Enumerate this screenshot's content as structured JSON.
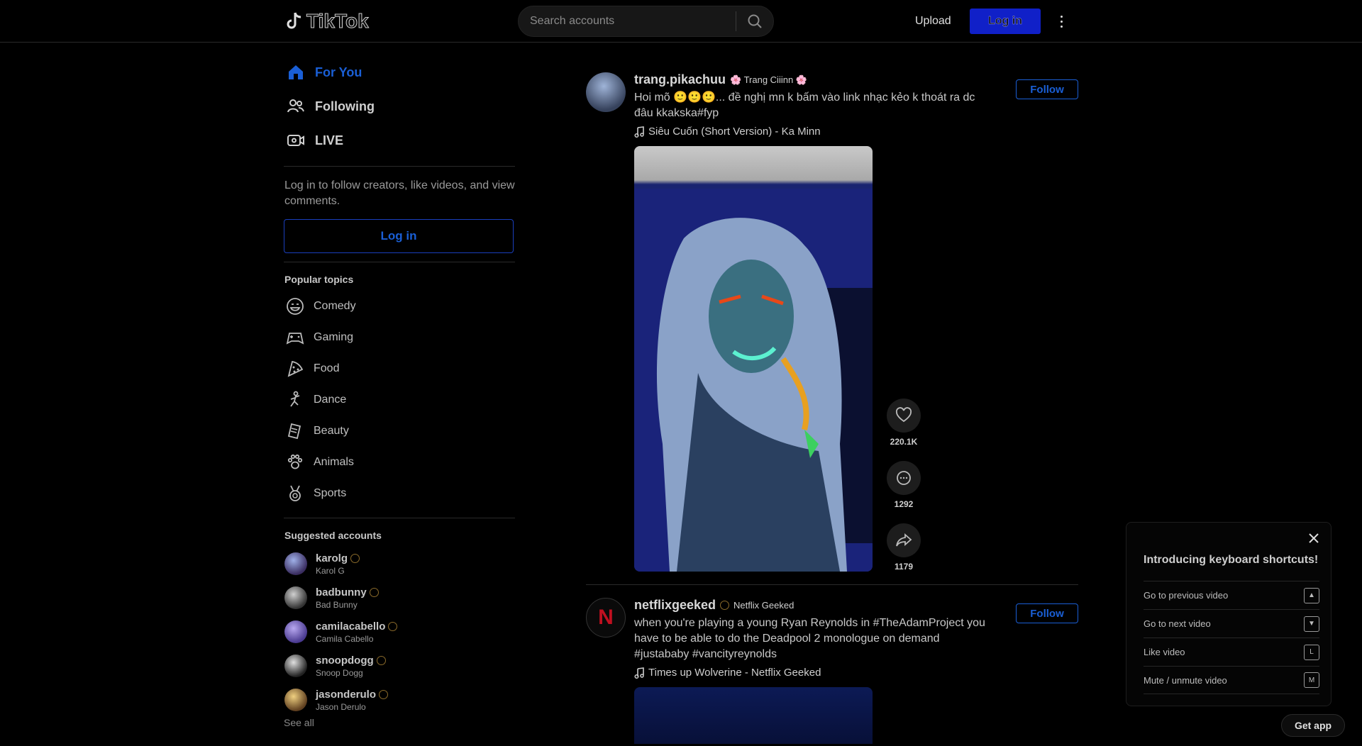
{
  "header": {
    "logo_text": "TikTok",
    "search_placeholder": "Search accounts",
    "upload_label": "Upload",
    "login_label": "Log in"
  },
  "sidebar": {
    "nav": [
      {
        "label": "For You",
        "icon": "home-icon"
      },
      {
        "label": "Following",
        "icon": "users-icon"
      },
      {
        "label": "LIVE",
        "icon": "live-icon"
      }
    ],
    "login_hint": "Log in to follow creators, like videos, and view comments.",
    "login_button": "Log in",
    "popular_title": "Popular topics",
    "topics": [
      "Comedy",
      "Gaming",
      "Food",
      "Dance",
      "Beauty",
      "Animals",
      "Sports"
    ],
    "suggested_title": "Suggested accounts",
    "accounts": [
      {
        "handle": "karolg",
        "name": "Karol G"
      },
      {
        "handle": "badbunny",
        "name": "Bad Bunny"
      },
      {
        "handle": "camilacabello",
        "name": "Camila Cabello"
      },
      {
        "handle": "snoopdogg",
        "name": "Snoop Dogg"
      },
      {
        "handle": "jasonderulo",
        "name": "Jason Derulo"
      }
    ],
    "see_all": "See all"
  },
  "feed": {
    "posts": [
      {
        "handle": "trang.pikachuu",
        "nickname": "🌸 Trang Ciiinn 🌸",
        "caption": "Hoi mõ 🙂🙂🙂... đề nghị mn k bấm vào link nhạc kẻo k thoát ra dc đâu kkakska#fyp",
        "music": "Siêu Cuốn (Short Version) - Ka Minn",
        "follow": "Follow",
        "likes": "220.1K",
        "comments": "1292",
        "shares": "1179"
      },
      {
        "handle": "netflixgeeked",
        "nickname": "Netflix Geeked",
        "caption": "when you're playing a young Ryan Reynolds in #TheAdamProject you have to be able to do the Deadpool 2 monologue on demand #justababy #vancityreynolds",
        "music": "Times up Wolverine - Netflix Geeked",
        "follow": "Follow"
      }
    ]
  },
  "keyboard": {
    "title": "Introducing keyboard shortcuts!",
    "shortcuts": [
      {
        "label": "Go to previous video",
        "icon": "arrow-up-key-icon"
      },
      {
        "label": "Go to next video",
        "icon": "arrow-down-key-icon"
      },
      {
        "label": "Like video",
        "icon": "l-key-icon"
      },
      {
        "label": "Mute / unmute video",
        "icon": "m-key-icon"
      }
    ]
  },
  "get_app": "Get app",
  "colors": {
    "accent": "#1a5fd6",
    "login_bg": "#1020c8",
    "background": "#000000"
  }
}
